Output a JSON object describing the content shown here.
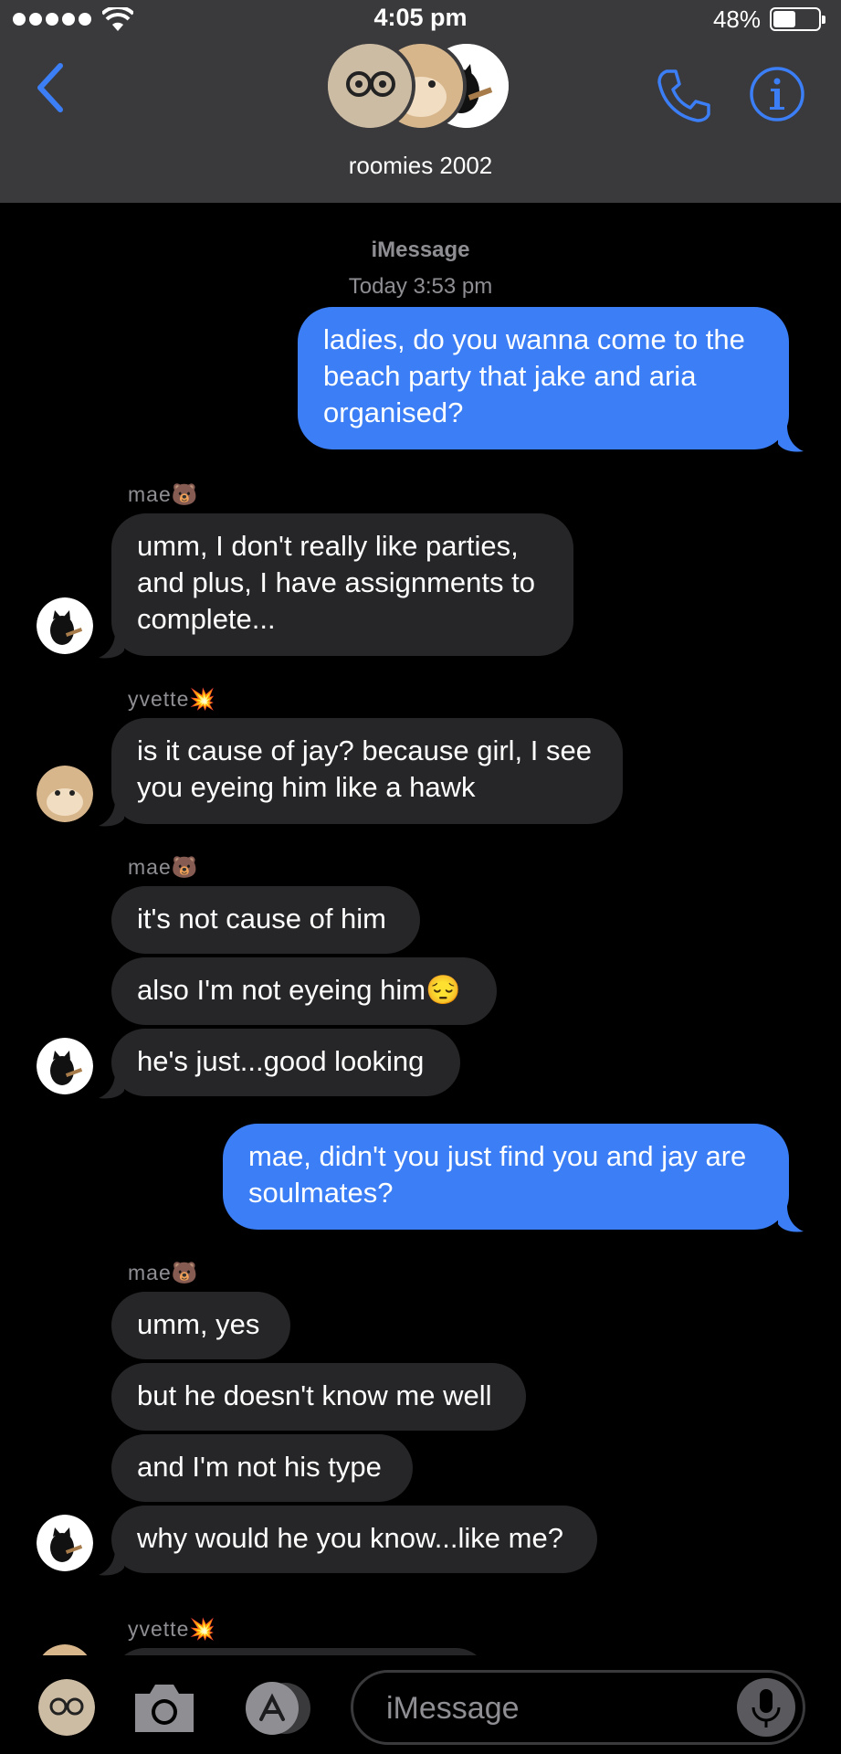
{
  "status_bar": {
    "time": "4:05 pm",
    "battery": "48%",
    "battery_level": 0.48
  },
  "header": {
    "title": "roomies 2002"
  },
  "thread": {
    "service": "iMessage",
    "timestamp": "Today 3:53 pm",
    "messages": [
      {
        "kind": "out",
        "text": "ladies, do you wanna come to the beach party that jake and aria organised?"
      },
      {
        "kind": "sender",
        "name": "mae🐻"
      },
      {
        "kind": "in",
        "text": "umm, I don't really like parties, and plus, I have assignments to complete..."
      },
      {
        "kind": "sender",
        "name": "yvette💥"
      },
      {
        "kind": "in",
        "text": "is it cause of jay? because girl, I see you eyeing him like a hawk"
      },
      {
        "kind": "sender",
        "name": "mae🐻"
      },
      {
        "kind": "in",
        "text": "it's not cause of him"
      },
      {
        "kind": "in",
        "text": "also I'm not eyeing him😔"
      },
      {
        "kind": "in",
        "text": "he's just...good looking"
      },
      {
        "kind": "out",
        "text": "mae, didn't you just find you and jay are soulmates?"
      },
      {
        "kind": "sender",
        "name": "mae🐻"
      },
      {
        "kind": "in",
        "text": "umm, yes"
      },
      {
        "kind": "in",
        "text": "but he doesn't know me well"
      },
      {
        "kind": "in",
        "text": "and I'm not his type"
      },
      {
        "kind": "in",
        "text": "why would he you know...like me?"
      },
      {
        "kind": "sender",
        "name": "yvette💥"
      }
    ]
  },
  "composer": {
    "placeholder": "iMessage"
  },
  "icons": {
    "back": "chevron-left-icon",
    "call": "phone-icon",
    "info": "info-icon",
    "camera": "camera-icon",
    "apps": "app-store-icon",
    "mic": "microphone-icon"
  },
  "colors": {
    "header_bg": "#3a3a3c",
    "accent": "#3b7ef5",
    "incoming_bubble": "#262628",
    "meta_text": "#8e8e93"
  }
}
